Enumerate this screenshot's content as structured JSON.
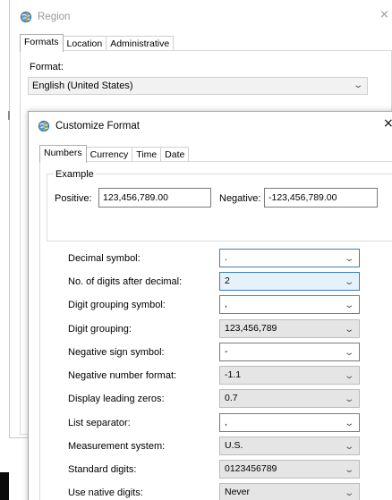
{
  "region": {
    "title": "Region",
    "close_glyph": "×",
    "tabs": [
      "Formats",
      "Location",
      "Administrative"
    ],
    "format_label": "Format:",
    "format_value": "English (United States)"
  },
  "dialog": {
    "title": "Customize Format",
    "close_glyph": "×",
    "tabs": [
      "Numbers",
      "Currency",
      "Time",
      "Date"
    ],
    "example": {
      "group_label": "Example",
      "positive_label": "Positive:",
      "positive_value": "123,456,789.00",
      "negative_label": "Negative:",
      "negative_value": "-123,456,789.00"
    },
    "settings": [
      {
        "label": "Decimal symbol:",
        "value": "."
      },
      {
        "label": "No. of digits after decimal:",
        "value": "2"
      },
      {
        "label": "Digit grouping symbol:",
        "value": ","
      },
      {
        "label": "Digit grouping:",
        "value": "123,456,789"
      },
      {
        "label": "Negative sign symbol:",
        "value": "-"
      },
      {
        "label": "Negative number format:",
        "value": "-1.1"
      },
      {
        "label": "Display leading zeros:",
        "value": "0.7"
      },
      {
        "label": "List separator:",
        "value": ","
      },
      {
        "label": "Measurement system:",
        "value": "U.S."
      },
      {
        "label": "Standard digits:",
        "value": "0123456789"
      },
      {
        "label": "Use native digits:",
        "value": "Never"
      }
    ]
  },
  "icons": {
    "region": "globe-icon",
    "dialog": "globe-icon",
    "dropdown": "chevron-down-icon"
  },
  "colors": {
    "focus_fill": "#e5f1fb",
    "focus_border": "#3c7fb1",
    "readonly_fill": "#e5e5e5"
  }
}
